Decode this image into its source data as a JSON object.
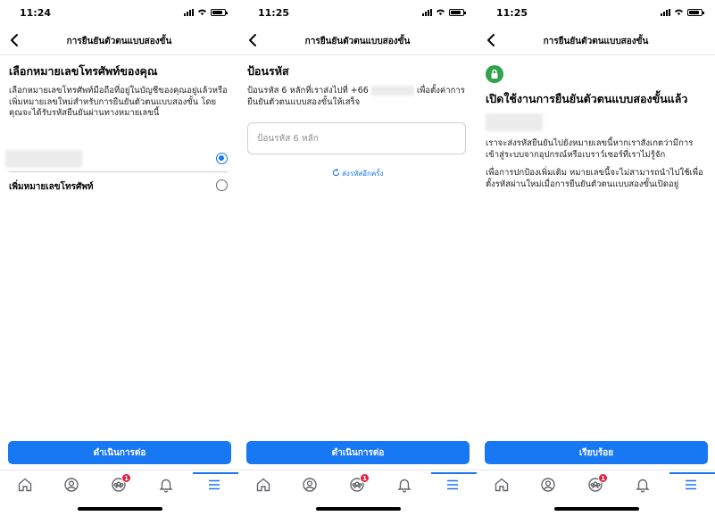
{
  "screens": [
    {
      "time": "11:24",
      "header_title": "การยืนยันตัวตนแบบสองขั้น",
      "heading": "เลือกหมายเลขโทรศัพท์ของคุณ",
      "body": "เลือกหมายเลขโทรศัพท์มือถือที่อยู่ในบัญชีของคุณอยู่แล้วหรือเพิ่มหมายเลขใหม่สำหรับการยืนยันตัวตนแบบสองขั้น โดยคุณจะได้รับรหัสยืนยันผ่านทางหมายเลขนี้",
      "add_phone_label": "เพิ่มหมายเลขโทรศัพท์",
      "continue_label": "ดำเนินการต่อ"
    },
    {
      "time": "11:25",
      "header_title": "การยืนยันตัวตนแบบสองขั้น",
      "heading": "ป้อนรหัส",
      "body_prefix": "ป้อนรหัส 6 หลักที่เราส่งไปที่ +66",
      "body_suffix": "เพื่อตั้งค่าการยืนยันตัวตนแบบสองขั้นให้เสร็จ",
      "input_placeholder": "ป้อนรหัส 6 หลัก",
      "resend_label": "ส่งรหัสอีกครั้ง",
      "continue_label": "ดำเนินการต่อ"
    },
    {
      "time": "11:25",
      "header_title": "การยืนยันตัวตนแบบสองขั้น",
      "heading": "เปิดใช้งานการยืนยันตัวตนแบบสองขั้นแล้ว",
      "paragraph_1": "เราจะส่งรหัสยืนยันไปยังหมายเลขนี้หากเราสังเกตว่ามีการเข้าสู่ระบบจากอุปกรณ์หรือเบราว์เซอร์ที่เราไม่รู้จัก",
      "paragraph_2": "เพื่อการปกป้องเพิ่มเติม หมายเลขนี้จะไม่สามารถนำไปใช้เพื่อตั้งรหัสผ่านใหม่เมื่อการยืนยันตัวตนแบบสองขั้นเปิดอยู่",
      "done_label": "เรียบร้อย"
    }
  ],
  "tabbar": {
    "groups_badge": "1",
    "icons": [
      "home-icon",
      "profile-icon",
      "groups-icon",
      "bell-icon",
      "menu-icon"
    ]
  },
  "colors": {
    "accent": "#1877f2",
    "success": "#31a24c",
    "badge": "#e41e3f"
  }
}
